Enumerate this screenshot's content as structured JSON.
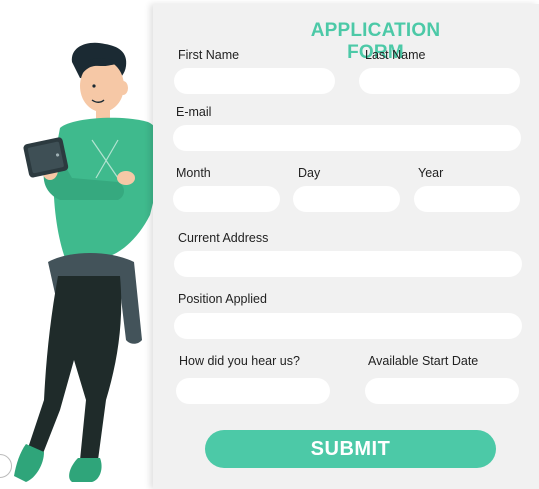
{
  "form": {
    "title": "APPLICATION FORM",
    "submit_label": "SUBMIT",
    "fields": {
      "first_name": {
        "label": "First Name",
        "value": ""
      },
      "last_name": {
        "label": "Last Name",
        "value": ""
      },
      "email": {
        "label": "E-mail",
        "value": ""
      },
      "month": {
        "label": "Month",
        "value": ""
      },
      "day": {
        "label": "Day",
        "value": ""
      },
      "year": {
        "label": "Year",
        "value": ""
      },
      "current_address": {
        "label": "Current Address",
        "value": ""
      },
      "position_applied": {
        "label": "Position Applied",
        "value": ""
      },
      "how_heard": {
        "label": "How did you hear us?",
        "value": ""
      },
      "start_date": {
        "label": "Available Start Date",
        "value": ""
      }
    }
  },
  "colors": {
    "accent": "#4cc9a7",
    "card_background": "#f1f1f1",
    "field_background": "#ffffff",
    "shirt": "#3fba8d",
    "pants": "#1f2b2a",
    "skin": "#f6c8a6",
    "hair": "#1b2a33"
  },
  "illustration": {
    "subject": "man-holding-tablet",
    "icon": "person-illustration"
  }
}
